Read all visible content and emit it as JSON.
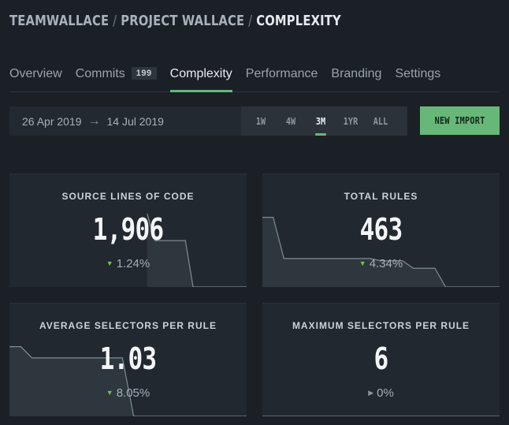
{
  "breadcrumb": {
    "team": "TEAMWALLACE",
    "separator": "/",
    "project": "PROJECT WALLACE",
    "current": "COMPLEXITY"
  },
  "tabs": [
    {
      "label": "Overview",
      "active": false
    },
    {
      "label": "Commits",
      "count": "199",
      "active": false
    },
    {
      "label": "Complexity",
      "active": true
    },
    {
      "label": "Performance",
      "active": false
    },
    {
      "label": "Branding",
      "active": false
    },
    {
      "label": "Settings",
      "active": false
    }
  ],
  "toolbar": {
    "date_from": "26 Apr 2019",
    "date_arrow": "→",
    "date_to": "14 Jul 2019",
    "ranges": [
      {
        "label": "1W",
        "active": false
      },
      {
        "label": "4W",
        "active": false
      },
      {
        "label": "3M",
        "active": true
      },
      {
        "label": "1YR",
        "active": false
      },
      {
        "label": "ALL",
        "active": false
      }
    ],
    "new_import_label": "NEW IMPORT"
  },
  "colors": {
    "accent": "#67b878",
    "background": "#1b2027",
    "card": "#212830",
    "delta_down": "#7bc04d"
  },
  "metrics": [
    {
      "title": "SOURCE LINES OF CODE",
      "value": "1,906",
      "delta": "1.24%",
      "trend": "down",
      "trend_icon": "triangle-down-icon",
      "sparkline": [
        null,
        null,
        null,
        null,
        null,
        null,
        null,
        null,
        null,
        null,
        null,
        null,
        null,
        null,
        null,
        null,
        null,
        null,
        0.98,
        0.62,
        0.62,
        0.62,
        0.62,
        0.62,
        0,
        0,
        0,
        0,
        0,
        0,
        0,
        0
      ]
    },
    {
      "title": "TOTAL RULES",
      "value": "463",
      "delta": "4.34%",
      "trend": "down",
      "trend_icon": "triangle-down-icon",
      "sparkline": [
        0.93,
        0.93,
        0.38,
        0.38,
        0.38,
        0.38,
        0.38,
        0.38,
        0.38,
        0.38,
        0.38,
        0.35,
        0.35,
        0.35,
        0.25,
        0.25,
        0.25,
        0,
        0,
        0,
        0,
        0,
        0
      ]
    },
    {
      "title": "AVERAGE SELECTORS PER RULE",
      "value": "1.03",
      "delta": "8.05%",
      "trend": "down",
      "trend_icon": "triangle-down-icon",
      "sparkline": [
        0.93,
        0.93,
        0.78,
        0.78,
        0.78,
        0.78,
        0.78,
        0.78,
        0.78,
        0.78,
        0.78,
        0,
        0,
        0,
        0,
        0,
        0,
        0,
        0,
        0,
        0,
        0
      ]
    },
    {
      "title": "MAXIMUM SELECTORS PER RULE",
      "value": "6",
      "delta": "0%",
      "trend": "flat",
      "trend_icon": "triangle-right-icon",
      "sparkline": [
        0,
        0
      ]
    }
  ]
}
